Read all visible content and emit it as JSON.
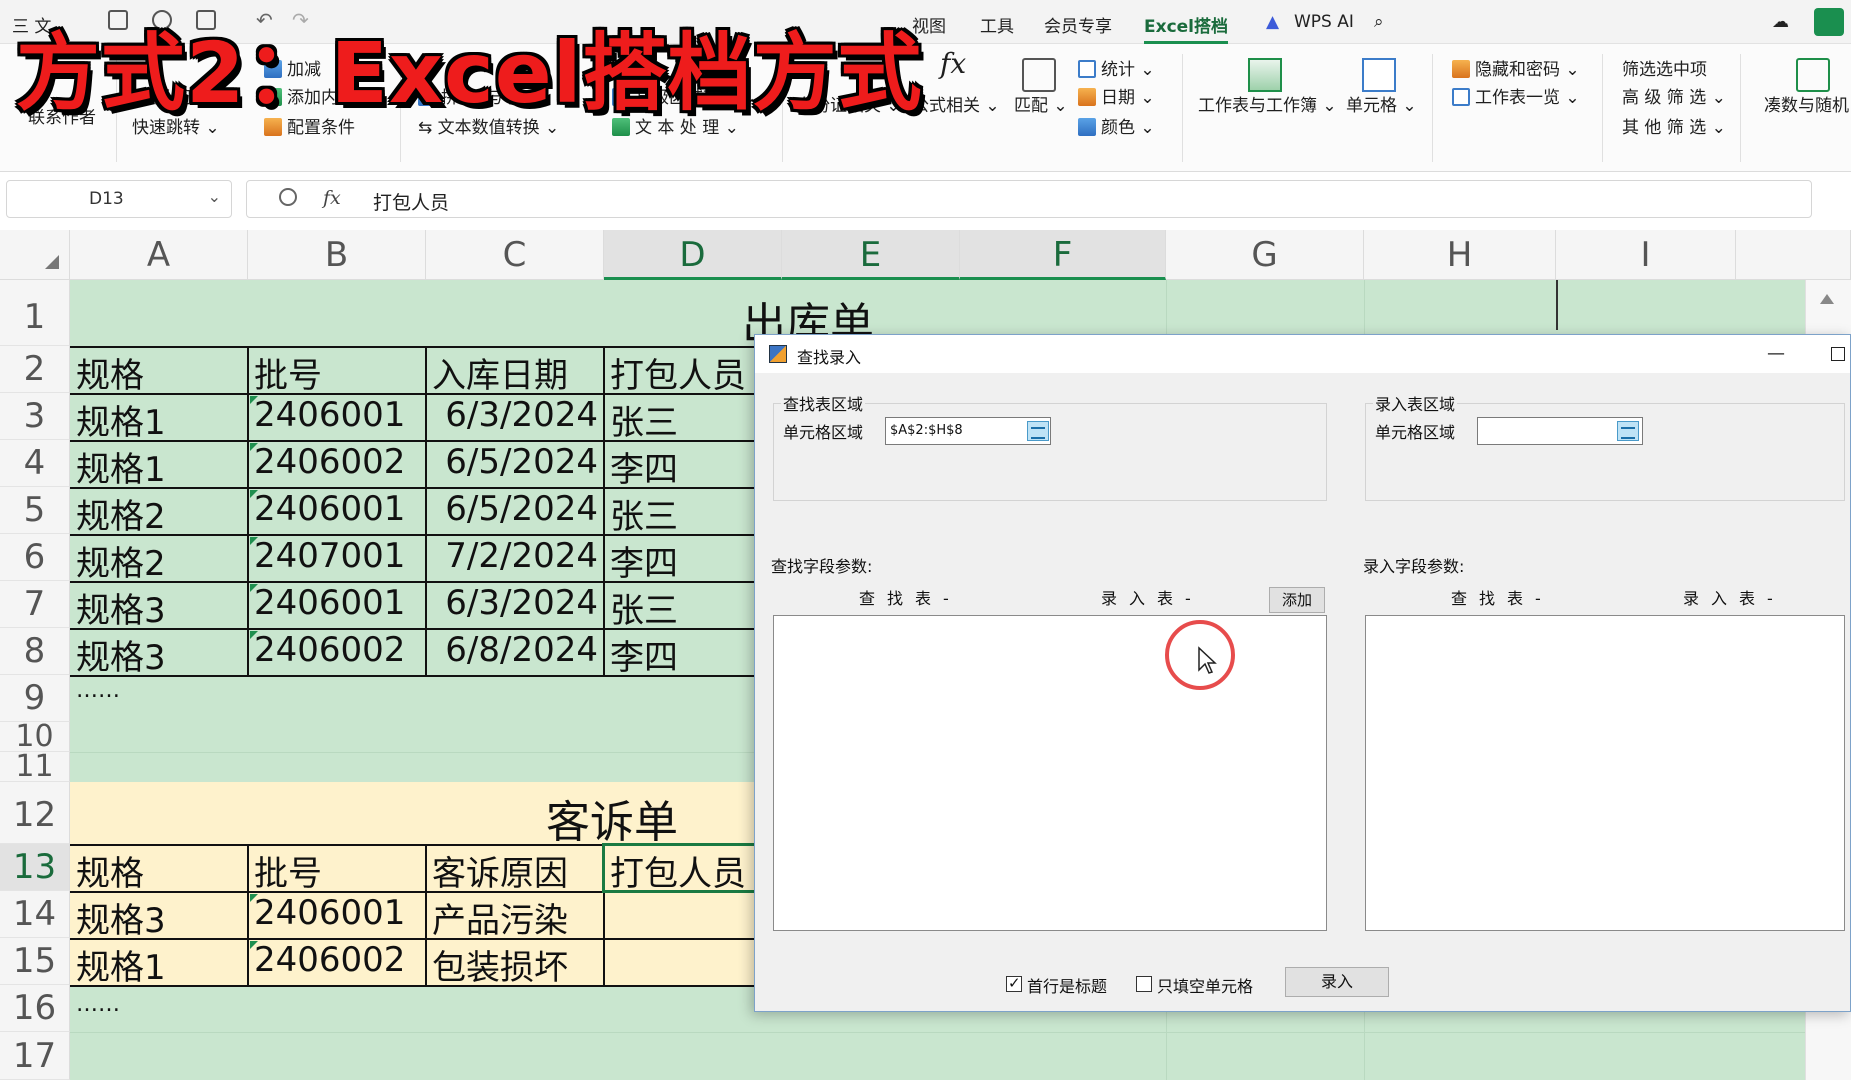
{
  "overlay": {
    "title": "方式2：Excel搭档方式"
  },
  "menubar": {
    "items": [
      "三 文",
      "视图",
      "工具",
      "会员专享",
      "Excel搭档",
      "WPS AI"
    ]
  },
  "ribbon": {
    "contact": "联系作者",
    "spotlight": "聚 光 灯",
    "quick_jump": "快速跳转",
    "add_content": "添加内容",
    "config_cond": "配置条件",
    "add_sub": "加减",
    "pinyin_english": "拼 音 与 英 文",
    "text_num": "文本数值转换",
    "high_region": "高级区域转换",
    "text_process": "文 本 处 理",
    "id_related": "身份证相关",
    "formula_related": "公式相关",
    "match": "匹配",
    "stats": "统计",
    "date": "日期",
    "color": "颜色",
    "worksheets": "工作表与工作簿",
    "cells": "单元格",
    "hide_encrypt": "隐藏和密码",
    "sheet_list": "工作表一览",
    "filter_selected": "筛选选中项",
    "advanced_filter": "高 级 筛 选",
    "other_filter": "其 他 筛 选",
    "random": "凑数与随机"
  },
  "formula": {
    "name_box": "D13",
    "fx": "fx",
    "value": "打包人员"
  },
  "columns": [
    "A",
    "B",
    "C",
    "D",
    "E",
    "F",
    "G",
    "H",
    "I"
  ],
  "rows": [
    "1",
    "2",
    "3",
    "4",
    "5",
    "6",
    "7",
    "8",
    "9",
    "10",
    "11",
    "12",
    "13",
    "14",
    "15",
    "16",
    "17"
  ],
  "sheet": {
    "outbound_title": "出库单",
    "outbound_headers": [
      "规格",
      "批号",
      "入库日期",
      "打包人员"
    ],
    "outbound_rows": [
      [
        "规格1",
        "2406001",
        "6/3/2024",
        "张三"
      ],
      [
        "规格1",
        "2406002",
        "6/5/2024",
        "李四"
      ],
      [
        "规格2",
        "2406001",
        "6/5/2024",
        "张三"
      ],
      [
        "规格2",
        "2407001",
        "7/2/2024",
        "李四"
      ],
      [
        "规格3",
        "2406001",
        "6/3/2024",
        "张三"
      ],
      [
        "规格3",
        "2406002",
        "6/8/2024",
        "李四"
      ]
    ],
    "ellipsis": "……",
    "complaint_title": "客诉单",
    "complaint_headers": [
      "规格",
      "批号",
      "客诉原因",
      "打包人员"
    ],
    "complaint_rows": [
      [
        "规格3",
        "2406001",
        "产品污染",
        ""
      ],
      [
        "规格1",
        "2406002",
        "包装损坏",
        ""
      ]
    ],
    "ellipsis2": "……"
  },
  "dialog": {
    "title": "查找录入",
    "lookup_group": "查找表区域",
    "entry_group": "录入表区域",
    "cell_range_label": "单元格区域",
    "lookup_range_value": "$A$2:$H$8",
    "entry_range_value": "",
    "lookup_field_label": "查找字段参数:",
    "entry_field_label": "录入字段参数:",
    "col_lookup": "查找表-",
    "col_entry": "录入表-",
    "add_button": "添加",
    "first_row_header": "首行是标题",
    "fill_empty_only": "只填空单元格",
    "entry_button": "录入"
  }
}
